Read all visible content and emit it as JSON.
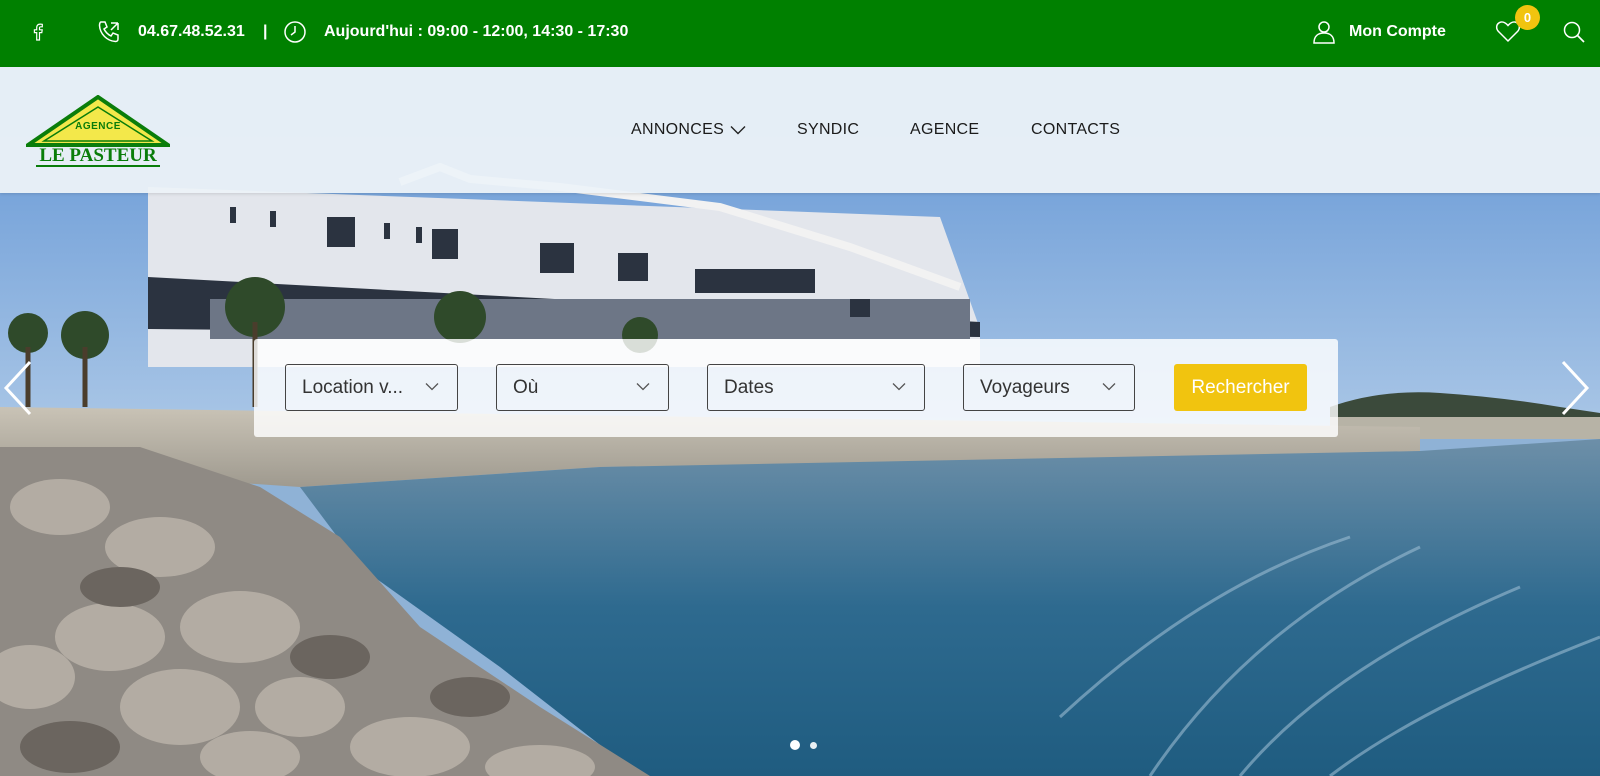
{
  "topbar": {
    "phone": "04.67.48.52.31",
    "separator": "|",
    "hours": "Aujourd'hui : 09:00 - 12:00, 14:30 - 17:30",
    "account_label": "Mon Compte",
    "favorites_count": "0",
    "background_color": "#008000"
  },
  "logo": {
    "tagline": "AGENCE",
    "name": "LE PASTEUR",
    "color": "#0a7d0a"
  },
  "nav": {
    "items": [
      {
        "label": "ANNONCES",
        "has_dropdown": true
      },
      {
        "label": "SYNDIC"
      },
      {
        "label": "AGENCE"
      },
      {
        "label": "CONTACTS"
      }
    ]
  },
  "search": {
    "type_label": "Location v...",
    "where_label": "Où",
    "dates_label": "Dates",
    "guests_label": "Voyageurs",
    "submit_label": "Rechercher",
    "button_color": "#f1c40f"
  },
  "slider": {
    "slides_count": 2,
    "active_index": 0
  },
  "icons": [
    "facebook-icon",
    "phone-icon",
    "clock-icon",
    "user-icon",
    "heart-icon",
    "search-icon",
    "chevron-down-icon",
    "arrow-left-icon",
    "arrow-right-icon"
  ]
}
